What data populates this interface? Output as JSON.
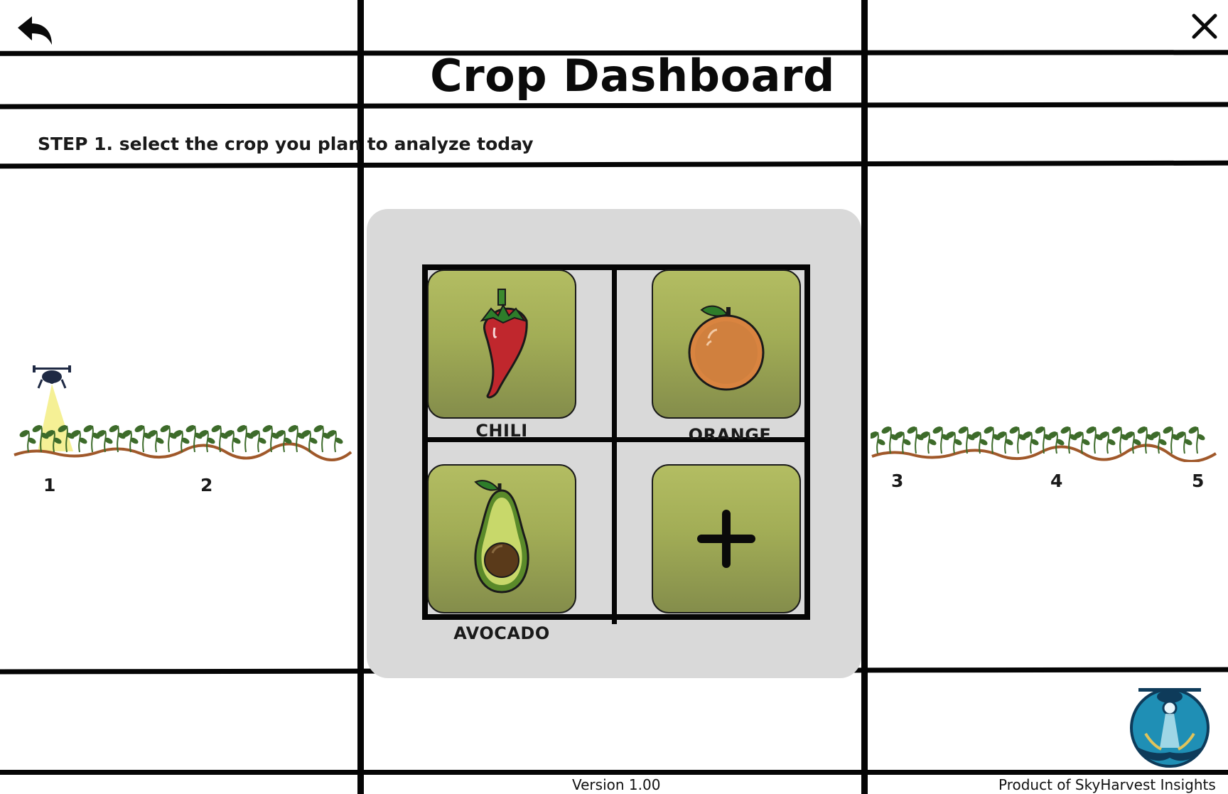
{
  "header": {
    "title": "Crop Dashboard",
    "back_icon": "back-arrow-icon",
    "close_icon": "close-icon"
  },
  "step": {
    "text": "STEP 1. select the crop you plan to analyze today"
  },
  "crops": {
    "chili": {
      "label": "CHILI",
      "icon": "chili-icon"
    },
    "orange": {
      "label": "ORANGE",
      "icon": "orange-icon"
    },
    "avocado": {
      "label": "AVOCADO",
      "icon": "avocado-icon"
    },
    "add": {
      "icon": "plus-icon"
    }
  },
  "field": {
    "left_labels": [
      "1",
      "2"
    ],
    "right_labels": [
      "3",
      "4",
      "5"
    ],
    "drone_icon": "drone-icon"
  },
  "footer": {
    "version": "Version 1.00",
    "product": "Product of SkyHarvest Insights",
    "logo_icon": "skyharvest-logo-icon"
  },
  "colors": {
    "tile_top": "#b3bd62",
    "tile_bottom": "#848d4b",
    "panel": "#d9d9d9",
    "soil": "#a0582a",
    "leaf": "#3d6b2a",
    "drone_beam": "#f4ee8a"
  }
}
